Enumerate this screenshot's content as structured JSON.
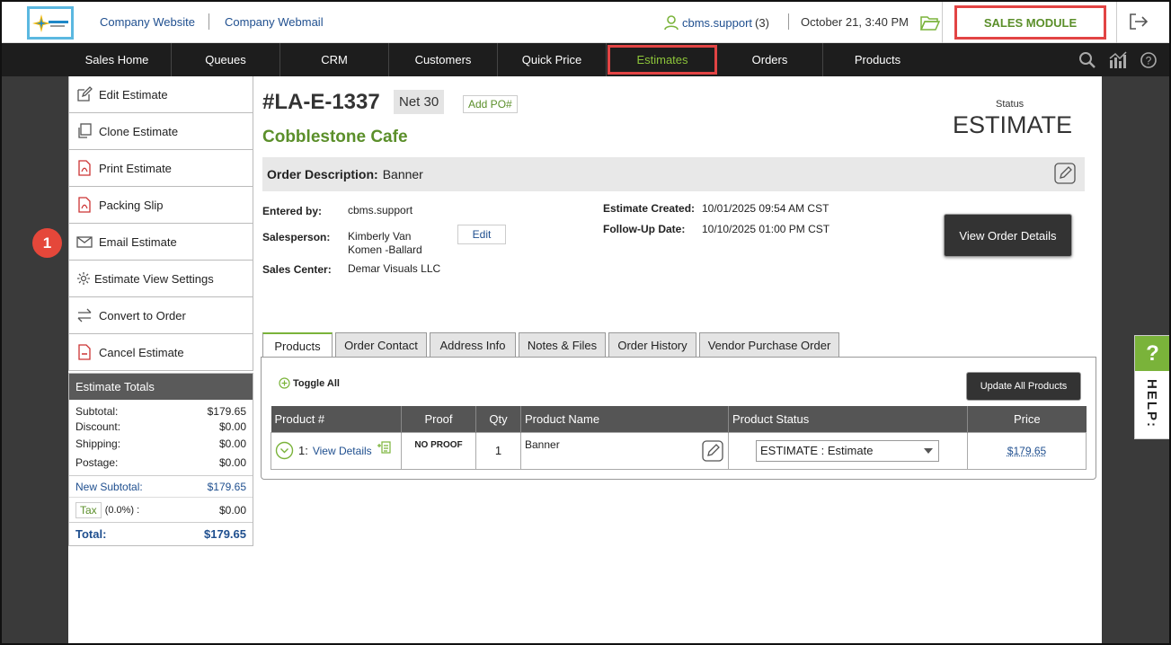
{
  "header": {
    "links": [
      "Company Website",
      "Company Webmail"
    ],
    "user": "cbms.support",
    "user_count": "(3)",
    "datetime": "October 21, 3:40 PM",
    "module": "SALES MODULE"
  },
  "nav": {
    "items": [
      "Sales Home",
      "Queues",
      "CRM",
      "Customers",
      "Quick Price",
      "Estimates",
      "Orders",
      "Products"
    ],
    "active": "Estimates"
  },
  "sidebar": {
    "items": [
      "Edit Estimate",
      "Clone Estimate",
      "Print Estimate",
      "Packing Slip",
      "Email Estimate",
      "Estimate View Settings",
      "Convert to Order",
      "Cancel Estimate"
    ],
    "step_badge": "1"
  },
  "totals": {
    "title": "Estimate Totals",
    "subtotal_label": "Subtotal:",
    "subtotal": "$179.65",
    "discount_label": "Discount:",
    "discount": "$0.00",
    "shipping_label": "Shipping:",
    "shipping": "$0.00",
    "postage_label": "Postage:",
    "postage": "$0.00",
    "new_subtotal_label": "New Subtotal:",
    "new_subtotal": "$179.65",
    "tax_label": "Tax",
    "tax_rate": "(0.0%) :",
    "tax": "$0.00",
    "total_label": "Total:",
    "total": "$179.65"
  },
  "estimate": {
    "number": "#LA-E-1337",
    "terms": "Net 30",
    "add_po": "Add PO#",
    "status_label": "Status",
    "status": "ESTIMATE",
    "customer": "Cobblestone Cafe",
    "desc_label": "Order Description:",
    "description": "Banner",
    "entered_by_label": "Entered by:",
    "entered_by": "cbms.support",
    "salesperson_label": "Salesperson:",
    "salesperson_1": "Kimberly Van",
    "salesperson_2": "Komen -Ballard",
    "edit_label": "Edit",
    "sales_center_label": "Sales Center:",
    "sales_center": "Demar Visuals LLC",
    "created_label": "Estimate Created:",
    "created": "10/01/2025 09:54 AM CST",
    "followup_label": "Follow-Up Date:",
    "followup": "10/10/2025 01:00 PM CST",
    "view_details_btn": "View Order Details"
  },
  "tabs": [
    "Products",
    "Order Contact",
    "Address Info",
    "Notes & Files",
    "Order History",
    "Vendor Purchase Order"
  ],
  "products": {
    "toggle_all": "Toggle All",
    "update_all": "Update All Products",
    "columns": [
      "Product #",
      "Proof",
      "Qty",
      "Product Name",
      "Product Status",
      "Price"
    ],
    "rows": [
      {
        "num": "1:",
        "link": "View Details",
        "proof": "NO PROOF",
        "qty": "1",
        "name": "Banner",
        "status": "ESTIMATE : Estimate",
        "price": "$179.65"
      }
    ]
  },
  "help": {
    "q": "?",
    "label": "HELP:"
  },
  "colors": {
    "accent_green": "#7ab33a",
    "link_blue": "#1f4f8f",
    "highlight_red": "#e24444",
    "nav_bg": "#1d1d1d"
  }
}
